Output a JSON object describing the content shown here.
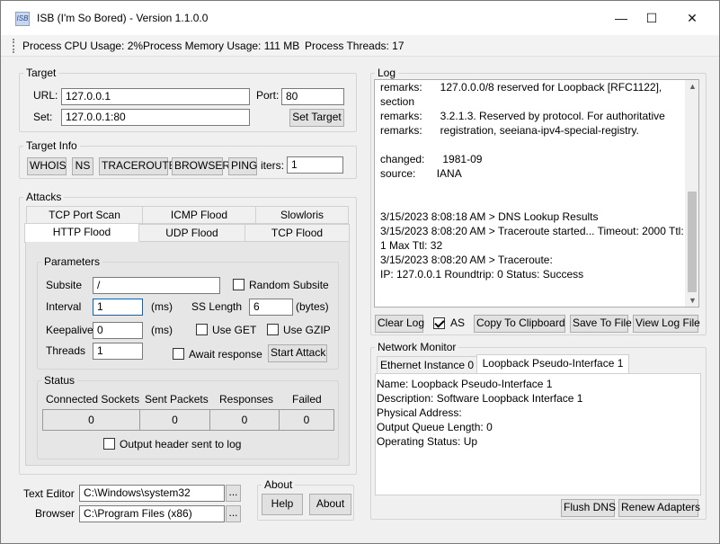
{
  "window": {
    "icon_text": "ISB",
    "title": "ISB (I'm So Bored) - Version 1.1.0.0",
    "minimize_glyph": "—",
    "maximize_glyph": "☐",
    "close_glyph": "✕"
  },
  "status_bar": {
    "cpu": "Process CPU Usage: 2%",
    "memory": "Process Memory Usage: 111 MB",
    "threads": "Process Threads: 17"
  },
  "target": {
    "legend": "Target",
    "url_label": "URL:",
    "url_value": "127.0.0.1",
    "port_label": "Port:",
    "port_value": "80",
    "set_label": "Set:",
    "set_value": "127.0.0.1:80",
    "set_target_button": "Set Target"
  },
  "target_info": {
    "legend": "Target Info",
    "buttons": [
      "WHOIS",
      "NS",
      "TRACEROUTE",
      "BROWSER",
      "PING"
    ],
    "iters_label": "iters:",
    "iters_value": "1"
  },
  "attacks": {
    "legend": "Attacks",
    "tabs_row1": [
      "TCP Port Scan",
      "ICMP Flood",
      "Slowloris"
    ],
    "tabs_row2": [
      "HTTP Flood",
      "UDP Flood",
      "TCP Flood"
    ],
    "active_tab": "HTTP Flood",
    "parameters": {
      "legend": "Parameters",
      "subsite_label": "Subsite",
      "subsite_value": "/",
      "random_subsite_label": "Random Subsite",
      "random_subsite_checked": false,
      "interval_label": "Interval",
      "interval_value": "1",
      "interval_unit": "(ms)",
      "ss_length_label": "SS Length",
      "ss_length_value": "6",
      "ss_length_unit": "(bytes)",
      "keepalive_label": "Keepalive",
      "keepalive_value": "0",
      "keepalive_unit": "(ms)",
      "use_get_label": "Use GET",
      "use_get_checked": false,
      "use_gzip_label": "Use GZIP",
      "use_gzip_checked": false,
      "threads_label": "Threads",
      "threads_value": "1",
      "await_response_label": "Await response",
      "await_response_checked": false,
      "start_attack_button": "Start Attack"
    },
    "status": {
      "legend": "Status",
      "headers": [
        "Connected Sockets",
        "Sent Packets",
        "Responses",
        "Failed"
      ],
      "values": [
        "0",
        "0",
        "0",
        "0"
      ],
      "output_header_label": "Output header sent to log",
      "output_header_checked": false
    }
  },
  "bottom": {
    "text_editor_label": "Text Editor",
    "text_editor_value": "C:\\Windows\\system32",
    "browser_label": "Browser",
    "browser_value": "C:\\Program Files (x86)",
    "browse_button": "...",
    "about_legend": "About",
    "help_button": "Help",
    "about_button": "About"
  },
  "log": {
    "legend": "Log",
    "lines": [
      "remarks:      127.0.0.0/8 reserved for Loopback [RFC1122],",
      "section",
      "remarks:      3.2.1.3. Reserved by protocol. For authoritative",
      "remarks:      registration, seeiana-ipv4-special-registry.",
      "",
      "changed:      1981-09",
      "source:       IANA",
      "",
      "",
      "3/15/2023 8:08:18 AM > DNS Lookup Results",
      "3/15/2023 8:08:20 AM > Traceroute started... Timeout: 2000 Ttl:",
      "1 Max Ttl: 32",
      "3/15/2023 8:08:20 AM > Traceroute:",
      "IP: 127.0.0.1 Roundtrip: 0 Status: Success"
    ],
    "clear_log_button": "Clear Log",
    "as_label": "AS",
    "as_checked": true,
    "copy_button": "Copy To Clipboard",
    "save_button": "Save To File",
    "view_button": "View Log File"
  },
  "network_monitor": {
    "legend": "Network Monitor",
    "tabs": [
      "Ethernet Instance 0",
      "Loopback Pseudo-Interface 1"
    ],
    "active_tab": "Loopback Pseudo-Interface 1",
    "details": [
      "Name: Loopback Pseudo-Interface 1",
      "Description: Software Loopback Interface 1",
      "Physical Address:",
      "Output Queue Length: 0",
      "Operating Status: Up"
    ],
    "flush_dns_button": "Flush DNS",
    "renew_adapters_button": "Renew Adapters"
  }
}
